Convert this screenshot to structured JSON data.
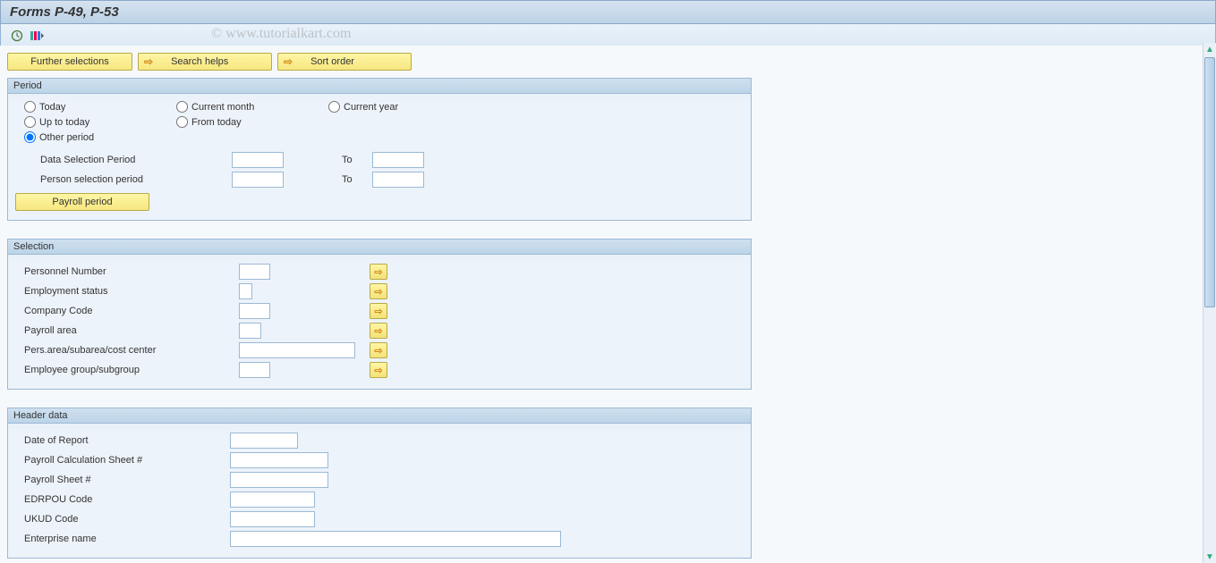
{
  "title": "Forms P-49, P-53",
  "watermark": "© www.tutorialkart.com",
  "top_buttons": {
    "further_selections": "Further selections",
    "search_helps": "Search helps",
    "sort_order": "Sort order"
  },
  "period": {
    "legend": "Period",
    "radios": {
      "today": "Today",
      "current_month": "Current month",
      "current_year": "Current year",
      "up_to_today": "Up to today",
      "from_today": "From today",
      "other_period": "Other period"
    },
    "selected": "other_period",
    "data_selection_period": "Data Selection Period",
    "person_selection_period": "Person selection period",
    "to_label": "To",
    "payroll_period_btn": "Payroll period"
  },
  "selection": {
    "legend": "Selection",
    "personnel_number": "Personnel Number",
    "employment_status": "Employment status",
    "company_code": "Company Code",
    "payroll_area": "Payroll area",
    "pers_area": "Pers.area/subarea/cost center",
    "employee_group": "Employee group/subgroup"
  },
  "header_data": {
    "legend": "Header data",
    "date_of_report": "Date of Report",
    "payroll_calc_sheet": "Payroll Calculation Sheet #",
    "payroll_sheet": "Payroll Sheet #",
    "edrpou": "EDRPOU Code",
    "ukud": "UKUD Code",
    "enterprise_name": "Enterprise name"
  }
}
